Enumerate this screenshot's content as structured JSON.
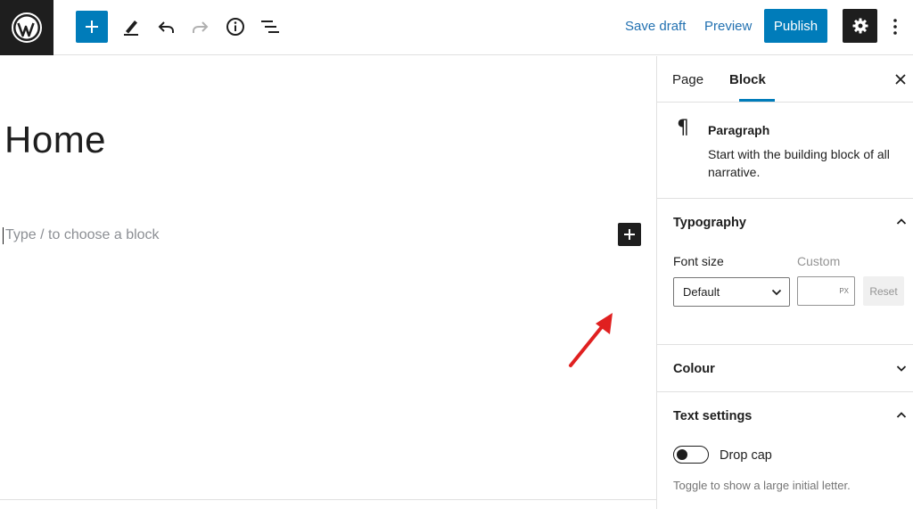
{
  "toolbar": {
    "logo_icon": "wordpress-logo",
    "icons": [
      "plus-icon",
      "pencil-icon",
      "undo-icon",
      "redo-icon",
      "info-icon",
      "list-view-icon"
    ],
    "save_draft_label": "Save draft",
    "preview_label": "Preview",
    "publish_label": "Publish",
    "settings_icon": "gear-icon",
    "more_icon": "more-vertical-icon"
  },
  "editor": {
    "title": "Home",
    "block_placeholder": "Type / to choose a block"
  },
  "sidebar": {
    "tabs": [
      {
        "label": "Page",
        "active": false
      },
      {
        "label": "Block",
        "active": true
      }
    ],
    "block": {
      "icon": "pilcrow-icon",
      "name": "Paragraph",
      "description": "Start with the building block of all narrative."
    },
    "typography": {
      "title": "Typography",
      "expanded": true,
      "font_size_label": "Font size",
      "custom_label": "Custom",
      "font_size_value": "Default",
      "unit": "PX",
      "reset_label": "Reset"
    },
    "colour": {
      "title": "Colour",
      "expanded": false
    },
    "text_settings": {
      "title": "Text settings",
      "expanded": true,
      "drop_cap_label": "Drop cap",
      "drop_cap_enabled": false,
      "help": "Toggle to show a large initial letter."
    }
  },
  "colors": {
    "accent": "#007cba",
    "link": "#2271b1",
    "dark": "#1e1e1e",
    "annotation_arrow": "#e02020"
  }
}
